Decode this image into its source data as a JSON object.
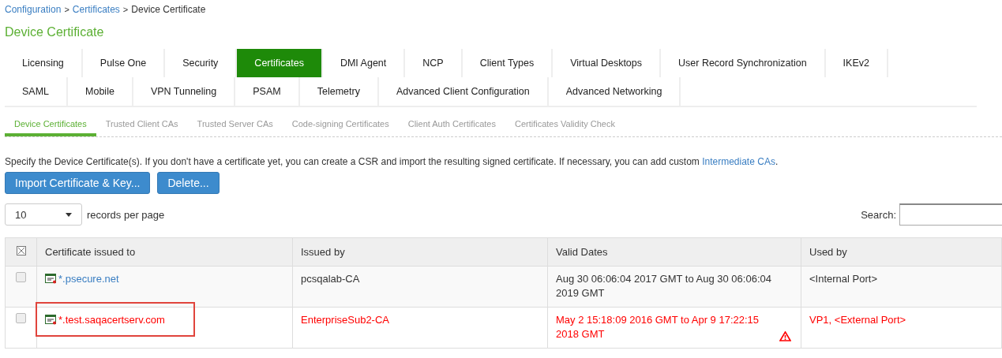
{
  "breadcrumb": [
    {
      "label": "Configuration",
      "link": true
    },
    {
      "label": "Certificates",
      "link": true
    },
    {
      "label": "Device Certificate",
      "link": false
    }
  ],
  "breadcrumb_separator": ">",
  "title": "Device Certificate",
  "tab_rows": [
    [
      {
        "label": "Licensing",
        "selected": false
      },
      {
        "label": "Pulse One",
        "selected": false
      },
      {
        "label": "Security",
        "selected": false
      },
      {
        "label": "Certificates",
        "selected": true
      },
      {
        "label": "DMI Agent",
        "selected": false
      },
      {
        "label": "NCP",
        "selected": false
      },
      {
        "label": "Client Types",
        "selected": false
      },
      {
        "label": "Virtual Desktops",
        "selected": false
      },
      {
        "label": "User Record Synchronization",
        "selected": false
      },
      {
        "label": "IKEv2",
        "selected": false
      }
    ],
    [
      {
        "label": "SAML",
        "selected": false
      },
      {
        "label": "Mobile",
        "selected": false
      },
      {
        "label": "VPN Tunneling",
        "selected": false
      },
      {
        "label": "PSAM",
        "selected": false
      },
      {
        "label": "Telemetry",
        "selected": false
      },
      {
        "label": "Advanced Client Configuration",
        "selected": false
      },
      {
        "label": "Advanced Networking",
        "selected": false
      }
    ]
  ],
  "subtabs": [
    {
      "label": "Device Certificates",
      "selected": true
    },
    {
      "label": "Trusted Client CAs",
      "selected": false
    },
    {
      "label": "Trusted Server CAs",
      "selected": false
    },
    {
      "label": "Code-signing Certificates",
      "selected": false
    },
    {
      "label": "Client Auth Certificates",
      "selected": false
    },
    {
      "label": "Certificates Validity Check",
      "selected": false
    }
  ],
  "description": {
    "text": "Specify the Device Certificate(s). If you don't have a certificate yet, you can create a CSR and import the resulting signed certificate. If necessary, you can add custom",
    "link": "Intermediate CAs",
    "end": "."
  },
  "buttons": [
    "Import Certificate & Key...",
    "Delete..."
  ],
  "page_size": {
    "value": "10",
    "label": "records per page"
  },
  "search": {
    "label": "Search:"
  },
  "table": {
    "columns": [
      "Certificate issued to",
      "Issued by",
      "Valid Dates",
      "Used by"
    ],
    "rows": [
      {
        "checked": false,
        "expired": false,
        "highlighted": false,
        "issued_to": "*.psecure.net",
        "issued_by": "pcsqalab-CA",
        "valid_dates": "Aug 30 06:06:04 2017 GMT to Aug 30 06:06:04 2019 GMT",
        "used_by": "<Internal Port>"
      },
      {
        "checked": false,
        "expired": true,
        "highlighted": true,
        "issued_to": "*.test.saqacertserv.com",
        "issued_by": "EnterpriseSub2-CA",
        "valid_dates": "May 2 15:18:09 2016 GMT to Apr 9 17:22:15 2018 GMT",
        "used_by": "VP1, <External Port>"
      }
    ]
  }
}
